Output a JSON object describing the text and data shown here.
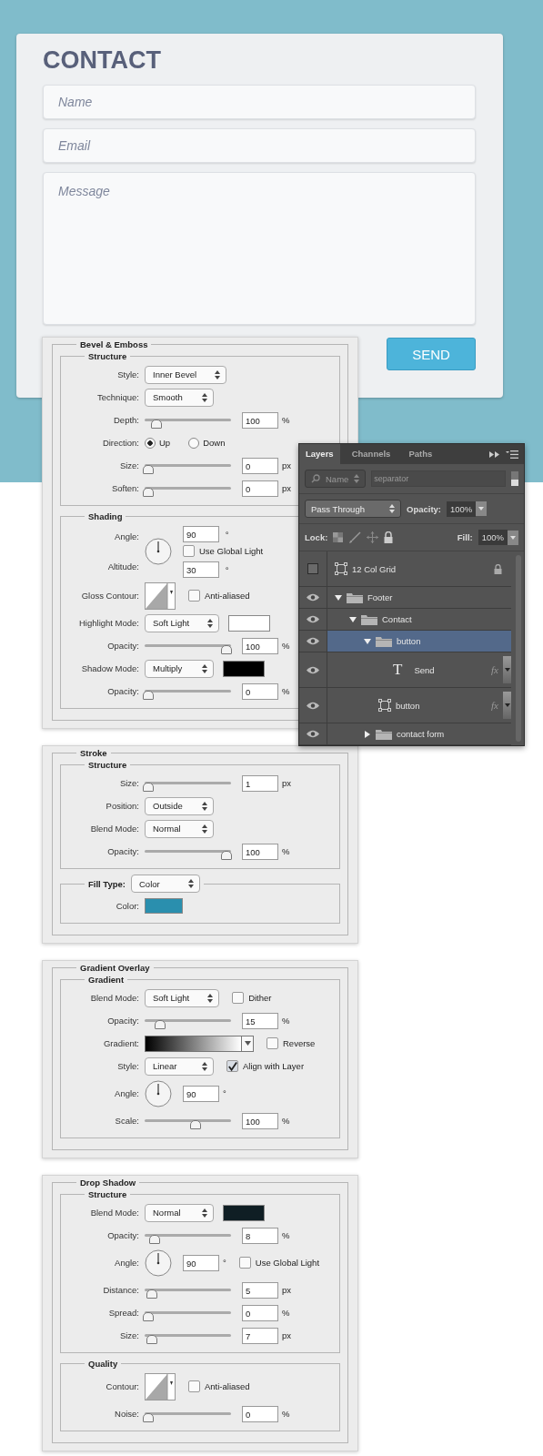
{
  "contact_form": {
    "title": "CONTACT",
    "fields": [
      {
        "kind": "line",
        "placeholder": "Name"
      },
      {
        "kind": "line",
        "placeholder": "Email"
      },
      {
        "kind": "area",
        "placeholder": "Message"
      }
    ],
    "button": "SEND"
  },
  "panels": [
    {
      "title": "Bevel & Emboss",
      "groups": [
        {
          "title": "Structure",
          "rows": [
            {
              "kind": "select",
              "label": "Style:",
              "value": "Inner Bevel"
            },
            {
              "kind": "select",
              "label": "Technique:",
              "value": "Smooth"
            },
            {
              "kind": "slider",
              "label": "Depth:",
              "level": 0.1,
              "value": "100",
              "unit": "%"
            },
            {
              "kind": "radio",
              "label": "Direction:",
              "options": [
                {
                  "label": "Up",
                  "selected": true
                },
                {
                  "label": "Down",
                  "selected": false
                }
              ]
            },
            {
              "kind": "slider",
              "label": "Size:",
              "level": 0,
              "value": "0",
              "unit": "px"
            },
            {
              "kind": "slider",
              "label": "Soften:",
              "level": 0,
              "value": "0",
              "unit": "px"
            }
          ]
        },
        {
          "title": "Shading",
          "rows": [
            {
              "kind": "light",
              "label": "Angle:",
              "value": "90",
              "unit": "°",
              "label_2": "Altitude:",
              "value_2": "30",
              "unit_2": "°",
              "checkbox": {
                "label": "Use Global Light",
                "checked": false
              }
            },
            {
              "kind": "contour",
              "label": "Gloss Contour:",
              "checkbox": {
                "label": "Anti-aliased",
                "checked": false
              }
            },
            {
              "kind": "select",
              "label": "Highlight Mode:",
              "value": "Soft Light",
              "color": "#ffffff"
            },
            {
              "kind": "slider",
              "label": "Opacity:",
              "level": 1,
              "value": "100",
              "unit": "%"
            },
            {
              "kind": "select",
              "label": "Shadow Mode:",
              "value": "Multiply",
              "color": "#000000"
            },
            {
              "kind": "slider",
              "label": "Opacity:",
              "level": 0,
              "value": "0",
              "unit": "%"
            }
          ]
        }
      ]
    },
    {
      "title": "Stroke",
      "groups": [
        {
          "title": "Structure",
          "rows": [
            {
              "kind": "slider",
              "label": "Size:",
              "level": 0,
              "value": "1",
              "unit": "px"
            },
            {
              "kind": "select",
              "label": "Position:",
              "value": "Outside"
            },
            {
              "kind": "select",
              "label": "Blend Mode:",
              "value": "Normal"
            },
            {
              "kind": "slider",
              "label": "Opacity:",
              "level": 1,
              "value": "100",
              "unit": "%"
            }
          ]
        },
        {
          "title": "Fill Type:",
          "select": "Color",
          "rows": [
            {
              "kind": "color",
              "label": "Color:",
              "color": "#2a8fae"
            }
          ]
        }
      ]
    },
    {
      "title": "Gradient Overlay",
      "groups": [
        {
          "title": "Gradient",
          "rows": [
            {
              "kind": "select",
              "label": "Blend Mode:",
              "value": "Soft Light",
              "checkbox": {
                "label": "Dither",
                "checked": false
              }
            },
            {
              "kind": "slider",
              "label": "Opacity:",
              "level": 0.15,
              "value": "15",
              "unit": "%"
            },
            {
              "kind": "gradient",
              "label": "Gradient:",
              "checkbox": {
                "label": "Reverse",
                "checked": false
              }
            },
            {
              "kind": "select",
              "label": "Style:",
              "value": "Linear",
              "checkbox": {
                "label": "Align with Layer",
                "checked": true
              }
            },
            {
              "kind": "angle",
              "label": "Angle:",
              "value": "90",
              "unit": "°"
            },
            {
              "kind": "slider",
              "label": "Scale:",
              "level": 0.6,
              "value": "100",
              "unit": "%"
            }
          ]
        }
      ]
    },
    {
      "title": "Drop Shadow",
      "groups": [
        {
          "title": "Structure",
          "rows": [
            {
              "kind": "select",
              "label": "Blend Mode:",
              "value": "Normal",
              "color": "#0f1e24"
            },
            {
              "kind": "slider",
              "label": "Opacity:",
              "level": 0.08,
              "value": "8",
              "unit": "%"
            },
            {
              "kind": "angle",
              "label": "Angle:",
              "value": "90",
              "unit": "°",
              "checkbox": {
                "label": "Use Global Light",
                "checked": false
              }
            },
            {
              "kind": "slider",
              "label": "Distance:",
              "level": 0.05,
              "value": "5",
              "unit": "px"
            },
            {
              "kind": "slider",
              "label": "Spread:",
              "level": 0,
              "value": "0",
              "unit": "%"
            },
            {
              "kind": "slider",
              "label": "Size:",
              "level": 0.05,
              "value": "7",
              "unit": "px"
            }
          ]
        },
        {
          "title": "Quality",
          "rows": [
            {
              "kind": "contour",
              "label": "Contour:",
              "checkbox": {
                "label": "Anti-aliased",
                "checked": false
              }
            },
            {
              "kind": "slider",
              "label": "Noise:",
              "level": 0,
              "value": "0",
              "unit": "%"
            }
          ]
        }
      ]
    }
  ],
  "layers_panel": {
    "tabs": [
      {
        "label": "Layers",
        "selected": true
      },
      {
        "label": "Channels",
        "selected": false
      },
      {
        "label": "Paths",
        "selected": false
      }
    ],
    "filter_kind": "Name",
    "filter_placeholder": "separator",
    "blend_mode": "Pass Through",
    "opacity_label": "Opacity:",
    "opacity": "100%",
    "lock_label": "Lock:",
    "fill_label": "Fill:",
    "fill": "100%",
    "layers": [
      {
        "name": "12 Col Grid",
        "kind": "shape",
        "visible": false,
        "selected": false,
        "locked": true
      },
      {
        "name": "Footer",
        "kind": "folder",
        "visible": true,
        "selected": false,
        "locked": false,
        "expanded": true,
        "children": [
          {
            "name": "Contact",
            "kind": "folder",
            "visible": true,
            "selected": false,
            "locked": false,
            "expanded": true,
            "children": [
              {
                "name": "button",
                "kind": "folder",
                "visible": true,
                "selected": true,
                "locked": false,
                "expanded": true,
                "children": [
                  {
                    "name": "Send",
                    "kind": "text",
                    "glyph": "T",
                    "visible": true,
                    "selected": false,
                    "locked": false,
                    "effects": "fx"
                  },
                  {
                    "name": "button",
                    "kind": "shape",
                    "visible": true,
                    "selected": false,
                    "locked": false,
                    "effects": "fx"
                  }
                ]
              },
              {
                "name": "contact form",
                "kind": "folder",
                "visible": true,
                "selected": false,
                "locked": false,
                "expanded": false
              }
            ]
          }
        ]
      }
    ]
  }
}
